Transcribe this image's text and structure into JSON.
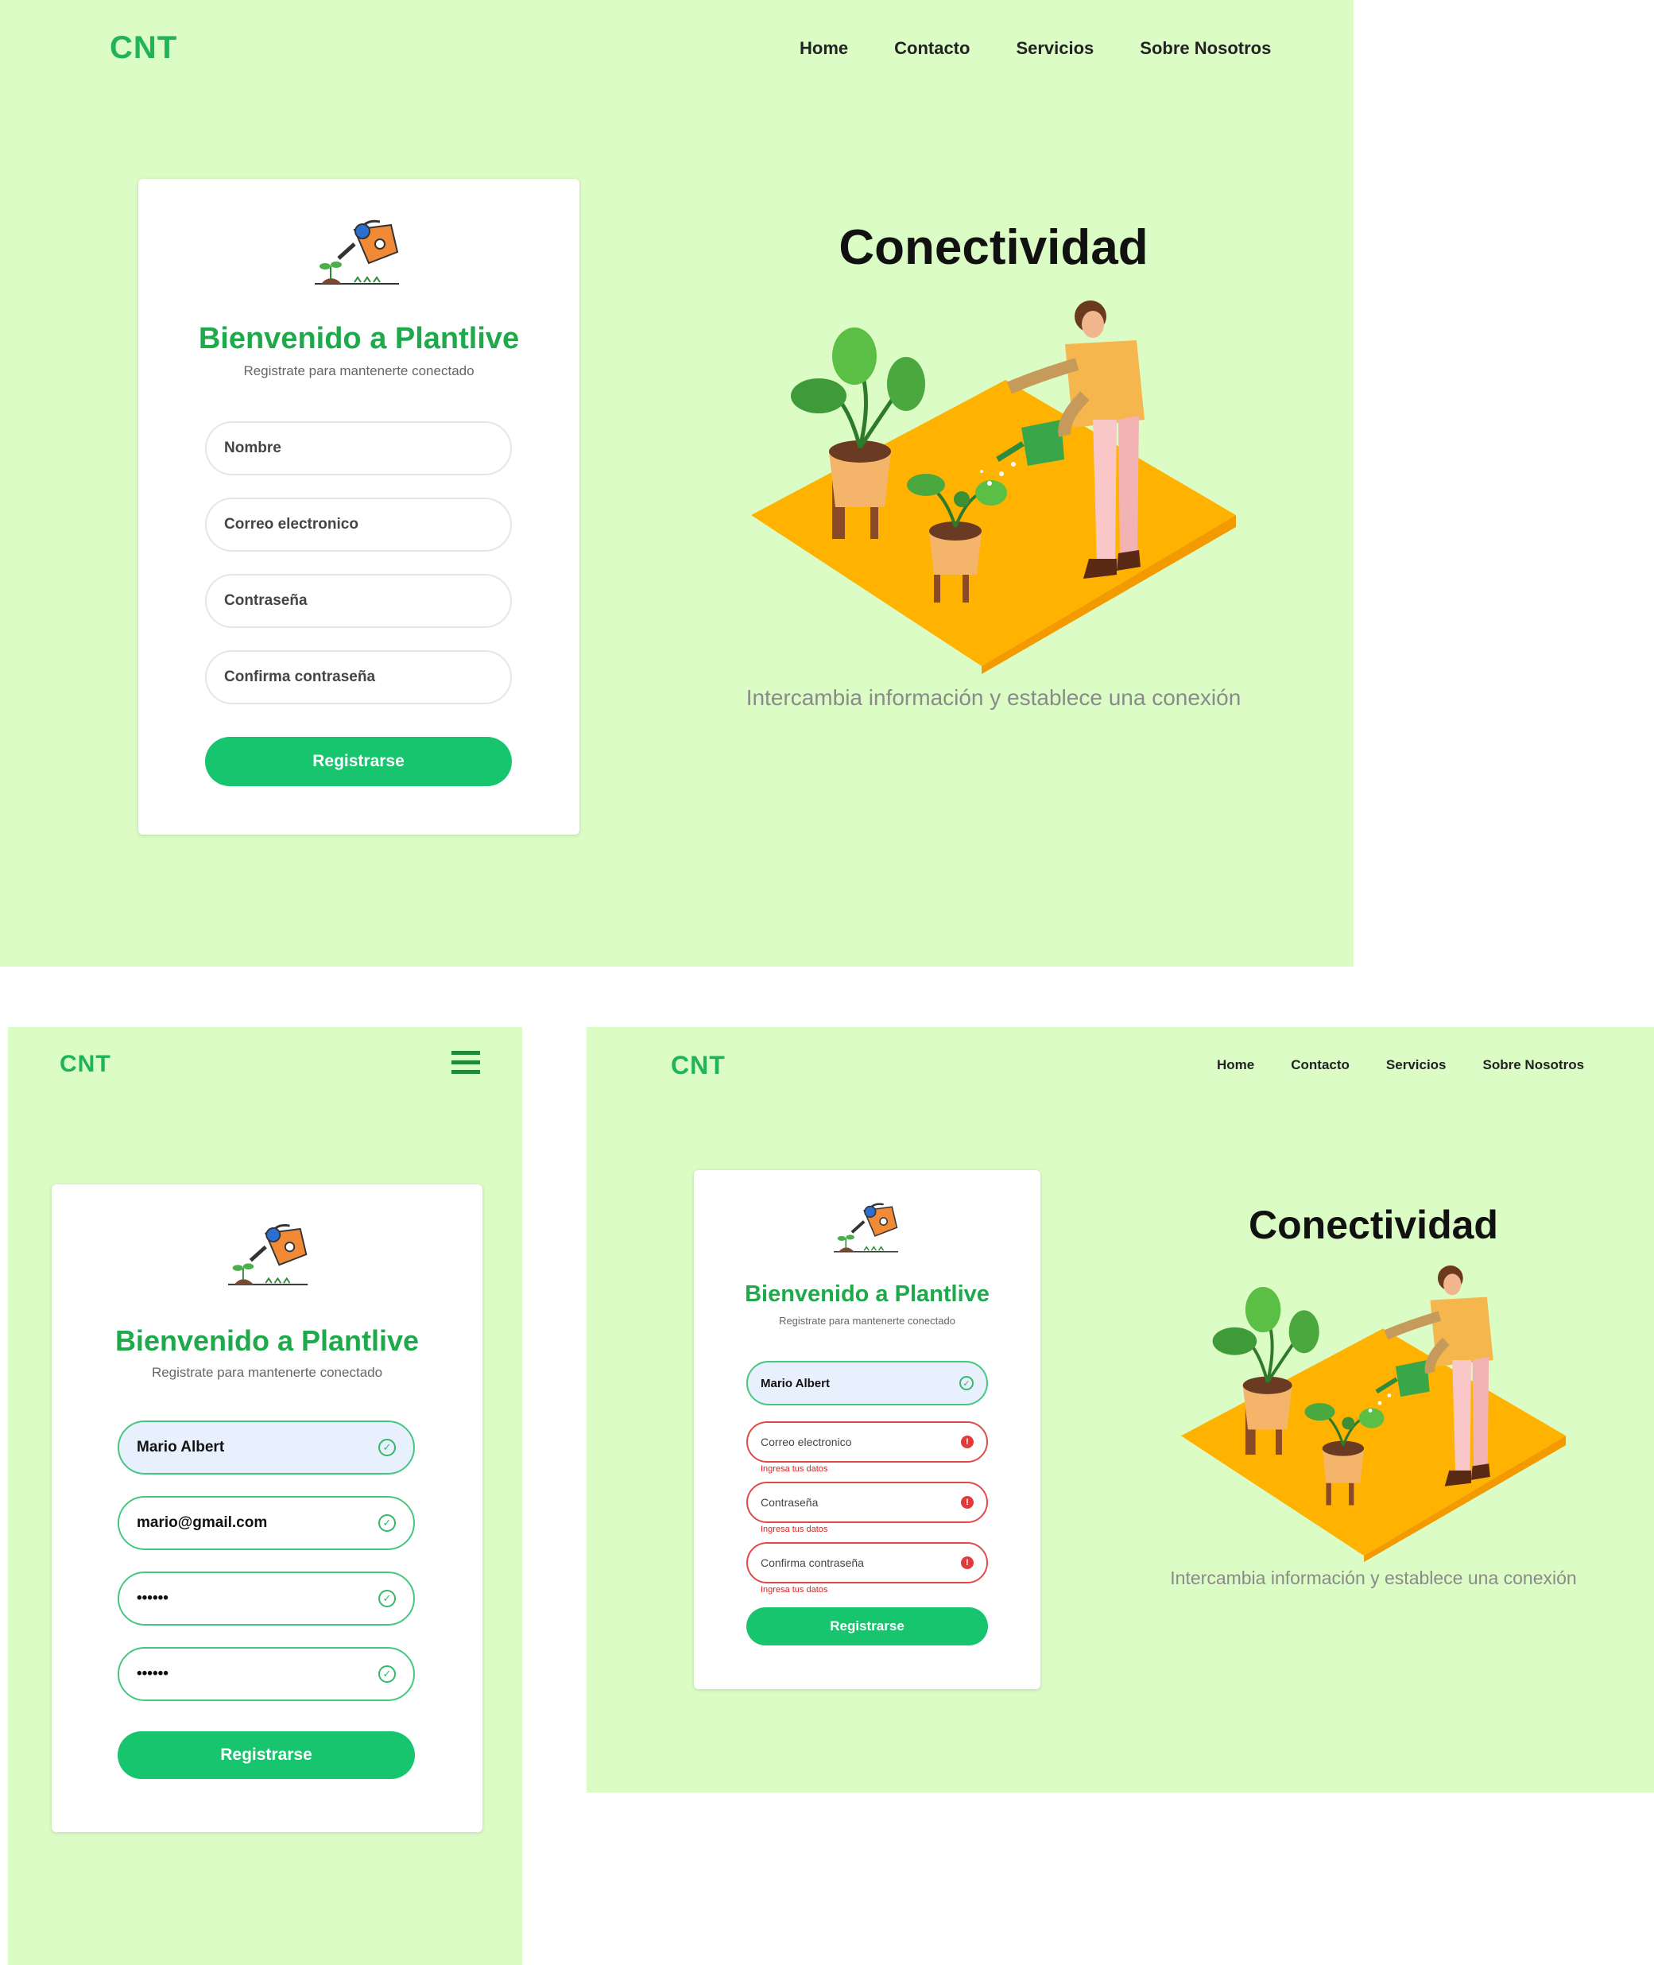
{
  "brand": "CNT",
  "nav": [
    "Home",
    "Contacto",
    "Servicios",
    "Sobre Nosotros"
  ],
  "card": {
    "title": "Bienvenido a Plantlive",
    "subtitle": "Registrate para mantenerte conectado",
    "button": "Registrarse"
  },
  "placeholders": {
    "name": "Nombre",
    "email": "Correo electronico",
    "password": "Contraseña",
    "confirm": "Confirma contraseña"
  },
  "mobile_values": {
    "name": "Mario Albert",
    "email": "mario@gmail.com",
    "password": "••••••",
    "confirm": "••••••"
  },
  "tablet_values": {
    "name": "Mario Albert"
  },
  "error_message": "Ingresa tus datos",
  "hero": {
    "title": "Conectividad",
    "subtitle": "Intercambia información y establece una conexión"
  },
  "colors": {
    "background": "#dbfcc5",
    "brand": "#20b45a",
    "button": "#17c56e",
    "error": "#e04a4a"
  }
}
